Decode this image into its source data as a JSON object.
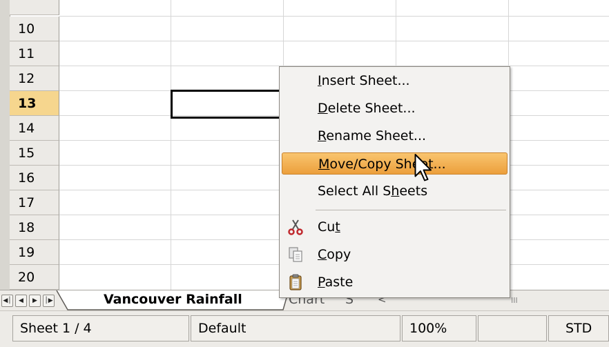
{
  "grid": {
    "rows": [
      {
        "label": "10",
        "active": false
      },
      {
        "label": "11",
        "active": false
      },
      {
        "label": "12",
        "active": false
      },
      {
        "label": "13",
        "active": true
      },
      {
        "label": "14",
        "active": false
      },
      {
        "label": "15",
        "active": false
      },
      {
        "label": "16",
        "active": false
      },
      {
        "label": "17",
        "active": false
      },
      {
        "label": "18",
        "active": false
      },
      {
        "label": "19",
        "active": false
      },
      {
        "label": "20",
        "active": false
      }
    ]
  },
  "context_menu": {
    "items": [
      {
        "pre": "",
        "u": "I",
        "post": "nsert Sheet..."
      },
      {
        "pre": "",
        "u": "D",
        "post": "elete Sheet..."
      },
      {
        "pre": "",
        "u": "R",
        "post": "ename Sheet..."
      },
      {
        "pre": "",
        "u": "M",
        "post": "ove/Copy Sheet..."
      },
      {
        "pre": "Select All S",
        "u": "h",
        "post": "eets"
      }
    ],
    "edit_items": [
      {
        "pre": "Cu",
        "u": "t",
        "post": "",
        "icon": "scissors-icon"
      },
      {
        "pre": "",
        "u": "C",
        "post": "opy",
        "icon": "copy-icon"
      },
      {
        "pre": "",
        "u": "P",
        "post": "aste",
        "icon": "paste-icon"
      }
    ]
  },
  "tabs": {
    "active": "Vancouver Rainfall",
    "second": "Chart",
    "third": "S",
    "fourth": "<"
  },
  "hscroll_thumb": "III",
  "statusbar": {
    "sheet": "Sheet 1 / 4",
    "style": "Default",
    "zoom": "100%",
    "empty": "",
    "mode": "STD"
  },
  "colors": {
    "menu_highlight": "#f0a84a",
    "active_row_header": "#f6d68e"
  }
}
